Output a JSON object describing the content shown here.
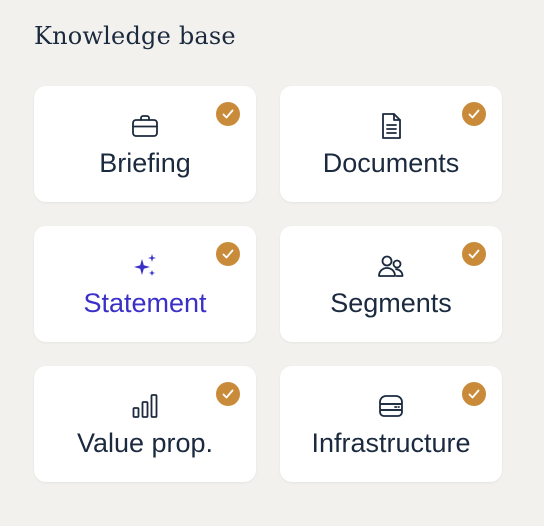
{
  "header": {
    "title": "Knowledge base"
  },
  "colors": {
    "background": "#f2f1ed",
    "card": "#ffffff",
    "text": "#1b2a3e",
    "active_text": "#3a2fc7",
    "check_badge": "#c98b3a"
  },
  "cards": [
    {
      "label": "Briefing",
      "icon": "briefcase-icon",
      "completed": true,
      "active": false
    },
    {
      "label": "Documents",
      "icon": "document-icon",
      "completed": true,
      "active": false
    },
    {
      "label": "Statement",
      "icon": "sparkles-icon",
      "completed": true,
      "active": true
    },
    {
      "label": "Segments",
      "icon": "users-icon",
      "completed": true,
      "active": false
    },
    {
      "label": "Value prop.",
      "icon": "bar-chart-icon",
      "completed": true,
      "active": false
    },
    {
      "label": "Infrastructure",
      "icon": "server-icon",
      "completed": true,
      "active": false
    }
  ]
}
